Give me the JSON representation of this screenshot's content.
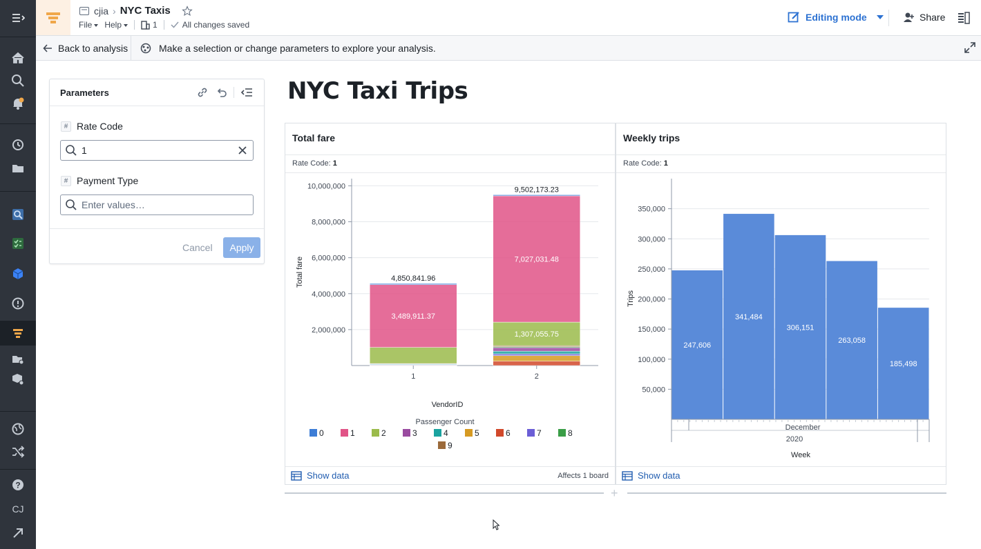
{
  "header": {
    "folder": "cjia",
    "title": "NYC Taxis",
    "menu_file": "File",
    "menu_help": "Help",
    "user_count": "1",
    "save_status": "All changes saved",
    "mode": "Editing mode",
    "share": "Share"
  },
  "rail": {
    "user_initials": "CJ"
  },
  "bar": {
    "back": "Back to analysis",
    "hint": "Make a selection or change parameters to explore your analysis."
  },
  "parameters": {
    "title": "Parameters",
    "rate_code_label": "Rate Code",
    "rate_code_value": "1",
    "payment_type_label": "Payment Type",
    "payment_type_placeholder": "Enter values…",
    "cancel": "Cancel",
    "apply": "Apply"
  },
  "page": {
    "title": "NYC Taxi Trips"
  },
  "fare_card": {
    "title": "Total fare",
    "filter_label": "Rate Code:",
    "filter_value": "1",
    "show_data": "Show data",
    "affects": "Affects 1 board"
  },
  "weekly_card": {
    "title": "Weekly trips",
    "filter_label": "Rate Code:",
    "filter_value": "1",
    "show_data": "Show data"
  },
  "colors": {
    "accent": "#2d72d2",
    "bar_blue": "#5a8bd9",
    "pc0": "#3d7dd6",
    "pc1": "#e15487",
    "pc2": "#9bbb4b",
    "pc3": "#9a4ba0",
    "pc4": "#1aa3a0",
    "pc5": "#d69a22",
    "pc6": "#d1492b",
    "pc7": "#6b5ed6",
    "pc8": "#3a9e47",
    "pc9": "#9b6a3a"
  },
  "chart_data": [
    {
      "type": "bar",
      "stacked": true,
      "title": "Total fare",
      "xlabel": "VendorID",
      "ylabel": "Total fare",
      "legend_title": "Passenger Count",
      "legend_position": "bottom",
      "grid": true,
      "ylim": [
        0,
        10400000
      ],
      "yticks": [
        "2,000,000",
        "4,000,000",
        "6,000,000",
        "8,000,000",
        "10,000,000"
      ],
      "categories": [
        "1",
        "2"
      ],
      "series": [
        {
          "name": "0",
          "values": [
            65000,
            60000
          ],
          "color": "#3d7dd6"
        },
        {
          "name": "1",
          "values": [
            3489911.37,
            7027031.48
          ],
          "color": "#e15487"
        },
        {
          "name": "2",
          "values": [
            900000,
            1307055.75
          ],
          "color": "#9bbb4b"
        },
        {
          "name": "3",
          "values": [
            30000,
            200000
          ],
          "color": "#9a4ba0"
        },
        {
          "name": "4",
          "values": [
            35000,
            150000
          ],
          "color": "#1aa3a0"
        },
        {
          "name": "5",
          "values": [
            12000,
            310000
          ],
          "color": "#d69a22"
        },
        {
          "name": "6",
          "values": [
            8000,
            240000
          ],
          "color": "#d1492b"
        },
        {
          "name": "7",
          "values": [
            26000,
            100000
          ],
          "color": "#6b5ed6"
        },
        {
          "name": "8",
          "values": [
            0,
            50000
          ],
          "color": "#3a9e47"
        },
        {
          "name": "9",
          "values": [
            0,
            58000
          ],
          "color": "#9b6a3a"
        }
      ],
      "totals": [
        "4,850,841.96",
        "9,502,173.23"
      ],
      "segment_labels": [
        {
          "category": "1",
          "series": "1",
          "label": "3,489,911.37"
        },
        {
          "category": "2",
          "series": "1",
          "label": "7,027,031.48"
        },
        {
          "category": "2",
          "series": "2",
          "label": "1,307,055.75"
        }
      ]
    },
    {
      "type": "bar",
      "title": "Weekly trips",
      "xlabel": "Week",
      "ylabel": "Trips",
      "grid": true,
      "ylim": [
        0,
        400000
      ],
      "yticks": [
        "50,000",
        "100,000",
        "150,000",
        "200,000",
        "250,000",
        "300,000",
        "350,000"
      ],
      "axis_month": "December",
      "axis_year": "2020",
      "values": [
        247606,
        341484,
        306151,
        263058,
        185498
      ],
      "labels": [
        "247,606",
        "341,484",
        "306,151",
        "263,058",
        "185,498"
      ],
      "color": "#5a8bd9"
    }
  ]
}
